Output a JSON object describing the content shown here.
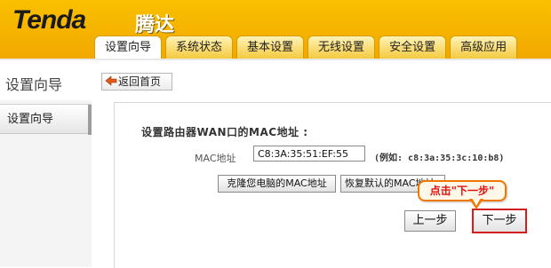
{
  "header": {
    "logo_text": "Tenda",
    "logo_cn": "腾达",
    "tabs": [
      {
        "label": "设置向导",
        "active": true
      },
      {
        "label": "系统状态",
        "active": false
      },
      {
        "label": "基本设置",
        "active": false
      },
      {
        "label": "无线设置",
        "active": false
      },
      {
        "label": "安全设置",
        "active": false
      },
      {
        "label": "高级应用",
        "active": false
      }
    ]
  },
  "title_row": {
    "section_title": "设置向导",
    "home_button": "返回首页"
  },
  "sidebar": {
    "items": [
      {
        "label": "设置向导"
      }
    ]
  },
  "content": {
    "panel_title": "设置路由器WAN口的MAC地址 :",
    "mac_label": "MAC地址",
    "mac_value": "C8:3A:35:51:EF:55",
    "mac_example": "(例如: c8:3a:35:3c:10:b8)",
    "clone_button": "克隆您电脑的MAC地址",
    "restore_button": "恢复默认的MAC地址",
    "prev_button": "上一步",
    "next_button": "下一步"
  },
  "callout": {
    "text": "点击\"下一步\""
  },
  "colors": {
    "header_bg": "#f4b400",
    "next_button_border": "#d21e1e",
    "callout_border": "#f07800",
    "callout_text": "#e01010"
  }
}
